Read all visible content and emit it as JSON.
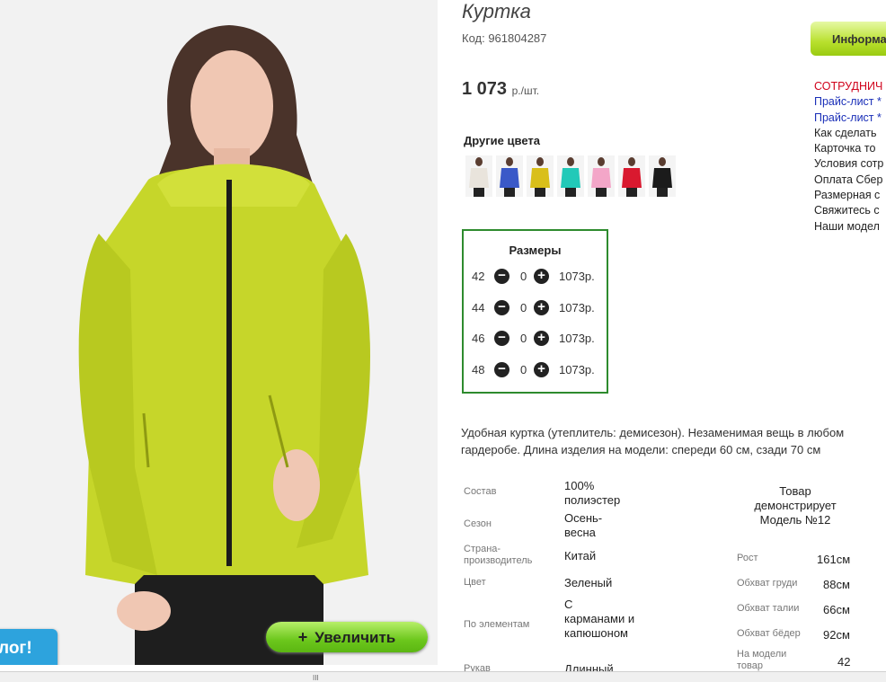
{
  "product": {
    "title": "Куртка",
    "code": "Код: 961804287",
    "price": "1 073",
    "price_unit": "р./шт."
  },
  "photo": {
    "zoom_label": "Увеличить",
    "zoom_icon": "plus-icon",
    "catalog_tab": "лог!",
    "jacket_color": "#c6d62a"
  },
  "info_button": {
    "label": "Информа"
  },
  "links": [
    {
      "label": "СОТРУДНИЧ",
      "color": "red"
    },
    {
      "label": "Прайс-лист *",
      "color": "blue"
    },
    {
      "label": "Прайс-лист *",
      "color": "blue"
    },
    {
      "label": "Как сделать",
      "color": "dark"
    },
    {
      "label": "Карточка то",
      "color": "dark"
    },
    {
      "label": "Условия сотр",
      "color": "dark"
    },
    {
      "label": "Оплата Сбер",
      "color": "dark"
    },
    {
      "label": "Размерная с",
      "color": "dark"
    },
    {
      "label": "Свяжитесь с",
      "color": "dark"
    },
    {
      "label": "Наши модел",
      "color": "dark"
    }
  ],
  "other_colors": {
    "label": "Другие цвета",
    "swatches": [
      "#e9e4dc",
      "#3a59c8",
      "#d9bf1a",
      "#22c9b8",
      "#f3a6c8",
      "#d9192f",
      "#1b1b1b"
    ]
  },
  "sizes": {
    "title": "Размеры",
    "rows": [
      {
        "size": "42",
        "qty": "0",
        "price": "1073р."
      },
      {
        "size": "44",
        "qty": "0",
        "price": "1073р."
      },
      {
        "size": "46",
        "qty": "0",
        "price": "1073р."
      },
      {
        "size": "48",
        "qty": "0",
        "price": "1073р."
      }
    ]
  },
  "description": "Удобная куртка (утеплитель: демисезон). Незаменимая вещь в любом гардеробе. Длина изделия на модели: спереди 60 см, сзади 70 см",
  "specs": {
    "composition_label": "Состав",
    "composition": "100% полиэстер",
    "season_label": "Сезон",
    "season": "Осень-весна",
    "country_label": "Страна-производитель",
    "country": "Китай",
    "color_label": "Цвет",
    "color": "Зеленый",
    "elements_label": "По элементам",
    "elements": "С карманами и капюшоном",
    "sleeve_label": "Рукав",
    "sleeve": "Длинный"
  },
  "model": {
    "heading": "Товар демонстрирует Модель №12",
    "height_label": "Рост",
    "height": "161см",
    "chest_label": "Обхват груди",
    "chest": "88см",
    "waist_label": "Обхват талии",
    "waist": "66см",
    "hips_label": "Обхват бёдер",
    "hips": "92см",
    "size_label": "На модели товар",
    "size": "42"
  },
  "scrollbar": {
    "grip": "III"
  }
}
